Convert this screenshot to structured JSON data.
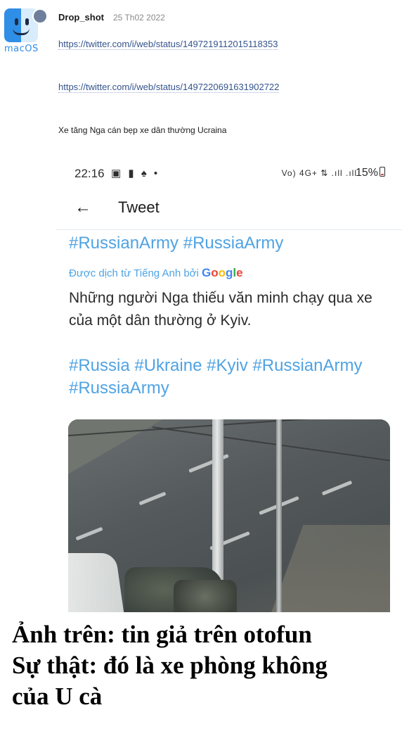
{
  "post": {
    "avatar": {
      "icon": "macos-finder-icon",
      "text": "macOS",
      "status_dot_color": "#6e7f9c"
    },
    "username": "Drop_shot",
    "date": "25 Th02 2022",
    "links": [
      "https://twitter.com/i/web/status/1497219112015118353",
      "https://twitter.com/i/web/status/1497220691631902722"
    ],
    "caption": "Xe tăng Nga cán bẹp xe dân thường Ucraina"
  },
  "embedded_screenshot": {
    "status_bar": {
      "time": "22:16",
      "left_icons": "▣ ▮ ♠ •",
      "signal": "Vo) 4G+ ⇅ .ıll .ıll",
      "battery_percent": "15%",
      "battery_level": 0.15
    },
    "nav": {
      "back_icon": "back-arrow-icon",
      "title": "Tweet"
    },
    "tweet": {
      "hashtags_top": "#RussianArmy #RussiaArmy",
      "translated_by": "Được dịch từ Tiếng Anh bởi",
      "translator_letters": [
        "G",
        "o",
        "o",
        "g",
        "l",
        "e"
      ],
      "translation_text": "Những người Nga thiếu văn minh chạy qua xe của một dân thường ở Kyiv.",
      "hashtags_bottom": " #Russia #Ukraine #Kyiv #RussianArmy #RussiaArmy",
      "link_color": "#4fa3e3"
    }
  },
  "meme_caption": {
    "lines": [
      "Ảnh trên: tin giả trên otofun",
      "Sự thật: đó là xe phòng không",
      "của U cà"
    ]
  }
}
